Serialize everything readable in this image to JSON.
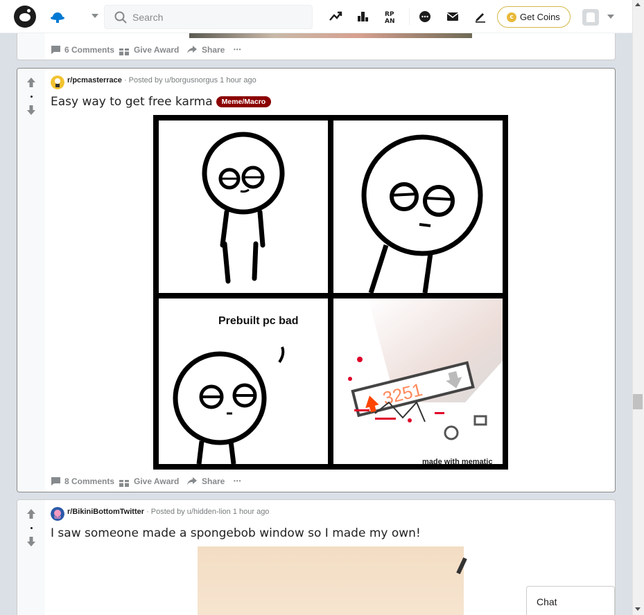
{
  "header": {
    "search_placeholder": "Search",
    "get_coins_label": "Get Coins",
    "coin_symbol": "c"
  },
  "posts": [
    {
      "actions": {
        "comments": "6 Comments",
        "award": "Give Award",
        "share": "Share",
        "more": "•••"
      }
    },
    {
      "subreddit": "r/pcmasterrace",
      "posted_by": "· Posted by u/borgusnorgus",
      "time": "1 hour ago",
      "title": "Easy way to get free karma",
      "flair": "Meme/Macro",
      "meme": {
        "caption": "Prebuilt pc bad",
        "score": "3251",
        "watermark": "made with mematic"
      },
      "actions": {
        "comments": "8 Comments",
        "award": "Give Award",
        "share": "Share",
        "more": "•••"
      }
    },
    {
      "subreddit": "r/BikiniBottomTwitter",
      "posted_by": "· Posted by u/hidden-lion",
      "time": "1 hour ago",
      "title": "I saw someone made a spongebob window so I made my own!"
    }
  ],
  "chat": {
    "label": "Chat"
  },
  "colors": {
    "flair_bg": "#8b0000",
    "coins_border": "#d4b846",
    "active_border": "#898989"
  }
}
